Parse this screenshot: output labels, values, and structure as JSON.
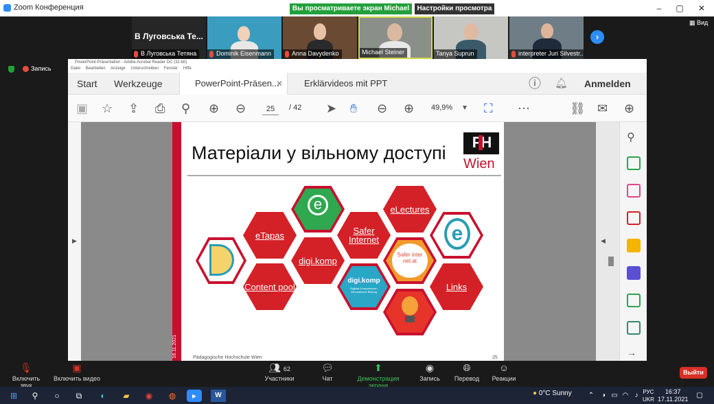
{
  "window": {
    "title": "Zoom Конференция",
    "minimize": "–",
    "maximize": "▢",
    "close": "✕"
  },
  "banner": {
    "viewing": "Вы просматриваете экран Michael Steiner",
    "view_options": "Настройки просмотра ⌄"
  },
  "participants": [
    {
      "name": "В Луговська Тетяна",
      "display": "В Луговська Те..."
    },
    {
      "name": "Dominik Eisenmann"
    },
    {
      "name": "Anna Davydenko"
    },
    {
      "name": "Michael Steiner"
    },
    {
      "name": "Tanya Suprun"
    },
    {
      "name": "interpreter Juri Silvestr..."
    }
  ],
  "view_label": "▦ Вид",
  "record_label": "Запись",
  "acrobat": {
    "title": "PowerPoint-Präsentation - Adobe Acrobat Reader DC (32-bit)",
    "menu": [
      "Datei",
      "Bearbeiten",
      "Anzeige",
      "Unterschreiben",
      "Fenster",
      "Hilfe"
    ],
    "tabs": {
      "start": "Start",
      "tools": "Werkzeuge",
      "doc1": "PowerPoint-Präsen...",
      "doc2": "Erklärvideos mit PPT",
      "signin": "Anmelden"
    },
    "page_current": "25",
    "page_total": "/ 42",
    "zoom": "49,9%"
  },
  "slide": {
    "title": "Матеріали у вільному доступі",
    "logo_top": "PH",
    "logo_bottom": "Wien",
    "date": "16.11.2021",
    "footer": "Pädagogische Hochschule Wien",
    "page": "25",
    "hex": {
      "etapas": "eTapas",
      "digikomp": "digi.komp",
      "safer_internet": "Safer Internet",
      "electures": "eLectures",
      "content_pool": "Content pool",
      "links": "Links",
      "safer_badge": "Safer inter net.at",
      "digikomp_logo": "digi.komp",
      "digikomp_sub": "Digitale Kompetenzen Informatische Bildung"
    }
  },
  "toolbar": {
    "mute": "Включить звук",
    "video": "Включить видео",
    "participants": "Участники",
    "participants_count": "62",
    "chat": "Чат",
    "share": "Демонстрация экрана",
    "record": "Запись",
    "translate": "Перевод",
    "reactions": "Реакции",
    "leave": "Выйти"
  },
  "taskbar": {
    "weather": "0°C  Sunny",
    "lang1": "РУС",
    "lang2": "UKR",
    "time": "16:37",
    "date": "17.11.2021"
  },
  "colors": {
    "zoom_blue": "#2d8cff",
    "banner_green": "#23a03c",
    "ph_red": "#c8102e",
    "leave_red": "#d93025"
  }
}
